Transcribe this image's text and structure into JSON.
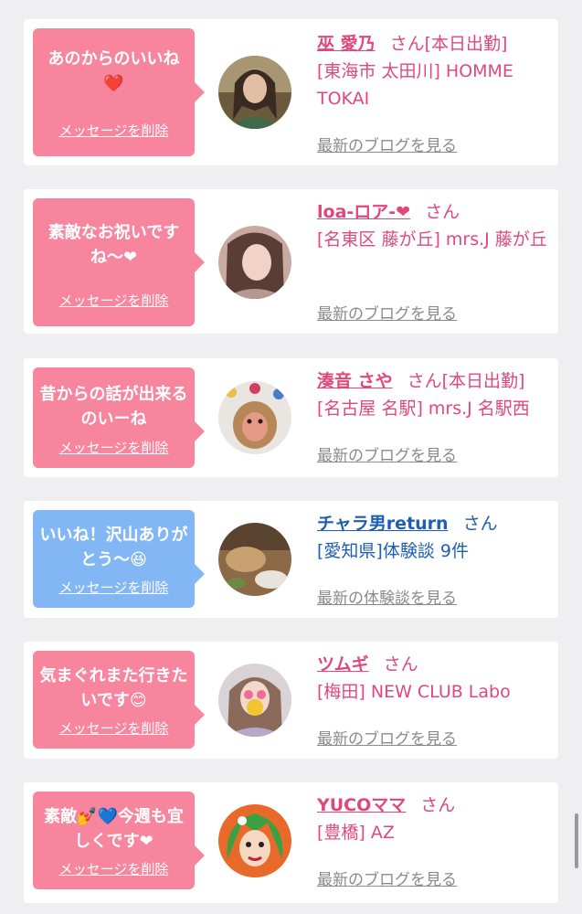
{
  "colors": {
    "pink_bubble": "#f7859d",
    "blue_bubble": "#83b6f4",
    "pink_text": "#e0487a",
    "blue_text": "#1d5fb3",
    "link_gray": "#8a8a8a"
  },
  "cards": [
    {
      "bubble_color": "pink",
      "message": "あのからのいいね",
      "message_emoji": "❤️",
      "delete_label": "メッセージを削除",
      "name": "巫 愛乃",
      "san": "さん",
      "work_status": "[本日出勤]",
      "shop": "[東海市 太田川] HOMME TOKAI",
      "more_link": "最新のブログを見る",
      "avatar": "avatar-photo"
    },
    {
      "bubble_color": "pink",
      "message": "素敵なお祝いですね〜❤",
      "message_emoji": "",
      "delete_label": "メッセージを削除",
      "name": "loa-ロア-❤",
      "san": "さん",
      "work_status": "",
      "shop": "[名東区 藤が丘] mrs.J 藤が丘",
      "more_link": "最新のブログを見る",
      "avatar": "avatar-photo"
    },
    {
      "bubble_color": "pink",
      "message": "昔からの話が出来るのいーね",
      "message_emoji": "",
      "delete_label": "メッセージを削除",
      "name": "湊音 さや",
      "san": "さん",
      "work_status": "[本日出勤]",
      "shop": "[名古屋 名駅] mrs.J 名駅西",
      "more_link": "最新のブログを見る",
      "avatar": "avatar-photo"
    },
    {
      "bubble_color": "blue",
      "message": "いいね！沢山ありがとう〜",
      "message_emoji": "😆",
      "delete_label": "メッセージを削除",
      "name": "チャラ男return",
      "san": "さん",
      "work_status": "",
      "shop": "[愛知県]体験談 9件",
      "more_link": "最新の体験談を見る",
      "avatar": "avatar-photo"
    },
    {
      "bubble_color": "pink",
      "message": "気まぐれまた行きたいです",
      "message_emoji": "😊",
      "delete_label": "メッセージを削除",
      "name": "ツムギ",
      "san": "さん",
      "work_status": "",
      "shop": "[梅田] NEW CLUB Labo",
      "more_link": "最新のブログを見る",
      "avatar": "avatar-photo"
    },
    {
      "bubble_color": "pink",
      "message": "素敵💅💙今週も宜しくです❤",
      "message_emoji": "",
      "delete_label": "メッセージを削除",
      "name": "YUCOママ",
      "san": "さん",
      "work_status": "",
      "shop": "[豊橋] AZ",
      "more_link": "最新のブログを見る",
      "avatar": "avatar-illustration"
    }
  ]
}
